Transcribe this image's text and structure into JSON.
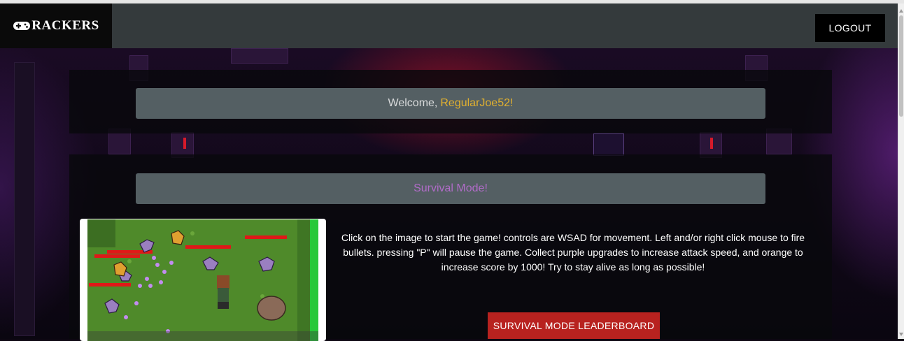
{
  "header": {
    "brand_text": "RACKERS",
    "brand_icon": "gamepad-icon",
    "logout_label": "LOGOUT"
  },
  "welcome": {
    "greeting": "Welcome,",
    "username": "RegularJoe52!"
  },
  "survival": {
    "title": "Survival Mode!",
    "description": "Click on the image to start the game! controls are WSAD for movement. Left and/or right click mouse to fire bullets. pressing \"P\" will pause the game. Collect purple upgrades to increase attack speed, and orange to increase score by 1000! Try to stay alive as long as possible!",
    "leaderboard_label": "SURVIVAL MODE LEADERBOARD"
  },
  "colors": {
    "username": "#e0b030",
    "survival_title": "#b16cc8",
    "leaderboard_button": "#b8221f",
    "banner": "#545f63",
    "header": "#343a3c"
  }
}
